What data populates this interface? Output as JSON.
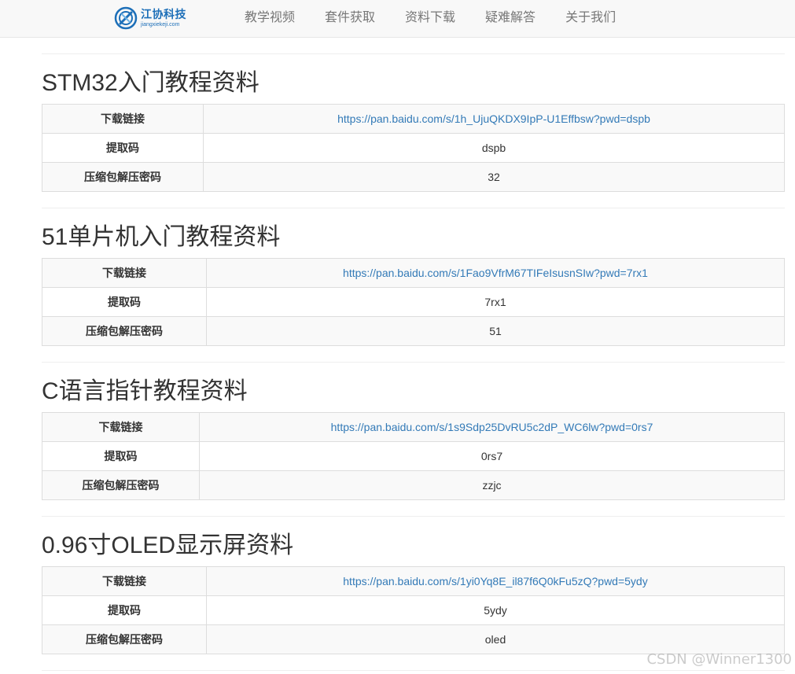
{
  "brand": {
    "name": "江协科技",
    "domain": "jiangxiekeji.com",
    "color": "#1d6fb8"
  },
  "nav": {
    "items": [
      "教学视频",
      "套件获取",
      "资料下载",
      "疑难解答",
      "关于我们"
    ]
  },
  "labels": {
    "link": "下载链接",
    "code": "提取码",
    "password": "压缩包解压密码"
  },
  "sections": [
    {
      "title": "STM32入门教程资料",
      "link": "https://pan.baidu.com/s/1h_UjuQKDX9IpP-U1Effbsw?pwd=dspb",
      "code": "dspb",
      "password": "32"
    },
    {
      "title": "51单片机入门教程资料",
      "link": "https://pan.baidu.com/s/1Fao9VfrM67TIFeIsusnSIw?pwd=7rx1",
      "code": "7rx1",
      "password": "51"
    },
    {
      "title": "C语言指针教程资料",
      "link": "https://pan.baidu.com/s/1s9Sdp25DvRU5c2dP_WC6lw?pwd=0rs7",
      "code": "0rs7",
      "password": "zzjc"
    },
    {
      "title": "0.96寸OLED显示屏资料",
      "link": "https://pan.baidu.com/s/1yi0Yq8E_il87f6Q0kFu5zQ?pwd=5ydy",
      "code": "5ydy",
      "password": "oled"
    }
  ],
  "watermark": "CSDN @Winner1300",
  "colors": {
    "link": "#337ab7",
    "navbar_bg": "#f8f8f8"
  }
}
